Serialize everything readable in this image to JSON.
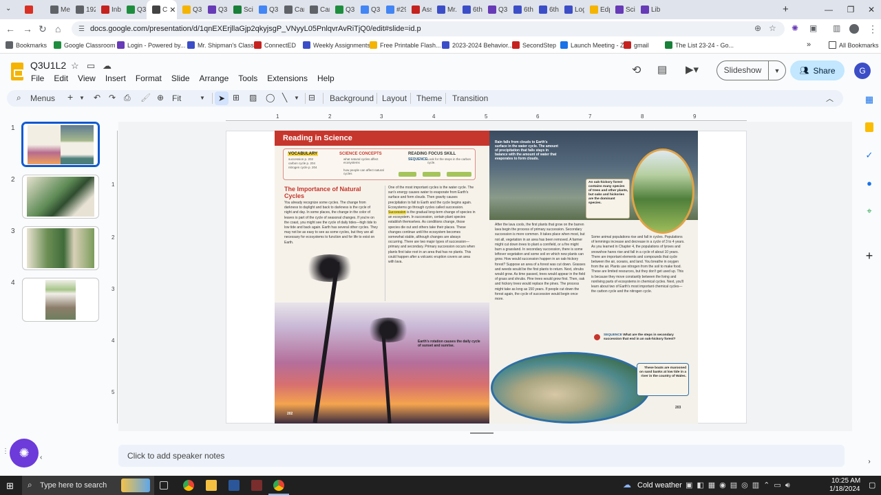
{
  "browser": {
    "tabs": [
      {
        "label": "",
        "icon": "circle-record-icon",
        "color": "#d93025"
      },
      {
        "label": "Me",
        "icon": "globe-icon",
        "color": "#5f6368"
      },
      {
        "label": "192",
        "icon": "clock-icon",
        "color": "#5f6368"
      },
      {
        "label": "Inb",
        "icon": "gmail-icon",
        "color": "#c5221f"
      },
      {
        "label": "Q3",
        "icon": "drive-icon",
        "color": "#1e8e3e"
      },
      {
        "label": "C",
        "icon": "speaker-icon",
        "color": "#444",
        "active": true
      },
      {
        "label": "Q3",
        "icon": "slides-icon",
        "color": "#f4b400"
      },
      {
        "label": "Q3",
        "icon": "forms-icon",
        "color": "#673ab7"
      },
      {
        "label": "Sci",
        "icon": "sheets-icon",
        "color": "#188038"
      },
      {
        "label": "Q3",
        "icon": "docs-icon",
        "color": "#4285f4"
      },
      {
        "label": "Car",
        "icon": "camera-icon",
        "color": "#5f6368"
      },
      {
        "label": "Car",
        "icon": "camera-icon",
        "color": "#5f6368"
      },
      {
        "label": "Q3",
        "icon": "drive-icon",
        "color": "#1e8e3e"
      },
      {
        "label": "Q3",
        "icon": "docs-icon",
        "color": "#4285f4"
      },
      {
        "label": "#29",
        "icon": "docs-icon",
        "color": "#4285f4"
      },
      {
        "label": "Ass",
        "icon": "classroom-icon",
        "color": "#c5221f"
      },
      {
        "label": "Mr.",
        "icon": "bookmark-icon",
        "color": "#3c4ec7"
      },
      {
        "label": "6th",
        "icon": "bookmark-icon",
        "color": "#3c4ec7"
      },
      {
        "label": "Q3",
        "icon": "gear-icon",
        "color": "#673ab7"
      },
      {
        "label": "6th",
        "icon": "bookmark-icon",
        "color": "#3c4ec7"
      },
      {
        "label": "6th",
        "icon": "bookmark-icon",
        "color": "#3c4ec7"
      },
      {
        "label": "Log",
        "icon": "chart-icon",
        "color": "#3c4ec7"
      },
      {
        "label": "Edp",
        "icon": "edpuzzle-icon",
        "color": "#f4b400"
      },
      {
        "label": "Sci",
        "icon": "bookmark-icon",
        "color": "#673ab7"
      },
      {
        "label": "Libr",
        "icon": "gear-icon",
        "color": "#673ab7"
      }
    ],
    "new_tab": "+",
    "url": "docs.google.com/presentation/d/1qnEXErjllaGjp2qkyjsgP_VNyyL05PnlqvrAvRiTjQ0/edit#slide=id.p",
    "bookmarks": [
      {
        "label": "Bookmarks",
        "color": "#5f6368"
      },
      {
        "label": "Google Classroom",
        "color": "#1e8e3e"
      },
      {
        "label": "Login - Powered by...",
        "color": "#673ab7"
      },
      {
        "label": "Mr. Shipman's Class",
        "color": "#3c4ec7"
      },
      {
        "label": "ConnectED",
        "color": "#c5221f"
      },
      {
        "label": "Weekly Assignments",
        "color": "#3c4ec7"
      },
      {
        "label": "Free Printable Flash...",
        "color": "#f4b400"
      },
      {
        "label": "2023-2024 Behavior...",
        "color": "#3c4ec7"
      },
      {
        "label": "SecondStep",
        "color": "#c5221f"
      },
      {
        "label": "Launch Meeting - Z...",
        "color": "#1a73e8"
      },
      {
        "label": "gmail",
        "color": "#c5221f"
      },
      {
        "label": "The List 23-24 - Go...",
        "color": "#188038"
      }
    ],
    "all_bookmarks": "All Bookmarks"
  },
  "app": {
    "title": "Q3U1L2",
    "menu": [
      "File",
      "Edit",
      "View",
      "Insert",
      "Format",
      "Slide",
      "Arrange",
      "Tools",
      "Extensions",
      "Help"
    ],
    "slideshow": "Slideshow",
    "share": "Share",
    "avatar_letter": "G"
  },
  "toolbar": {
    "menus": "Menus",
    "zoom": "Fit",
    "background": "Background",
    "layout": "Layout",
    "theme": "Theme",
    "transition": "Transition"
  },
  "slides": {
    "numbers": [
      "1",
      "2",
      "3",
      "4"
    ]
  },
  "ruler": {
    "h": [
      "1",
      "2",
      "3",
      "4",
      "5",
      "6",
      "7",
      "8",
      "9"
    ],
    "v": [
      "1",
      "2",
      "3",
      "4",
      "5"
    ]
  },
  "slide_content": {
    "header": "Reading in Science",
    "vocab_title": "VOCABULARY",
    "vocab_items": [
      "succession p. 202",
      "carbon cycle p. 204",
      "nitrogen cycle p. 204"
    ],
    "concepts_title": "SCIENCE CONCEPTS",
    "concepts_items": [
      "what natural cycles affect ecosystems",
      "how people can affect natural cycles"
    ],
    "focus_title": "READING FOCUS SKILL",
    "focus_sequence": "SEQUENCE",
    "focus_text": "Look for the steps in the carbon cycle.",
    "article_title": "The Importance of Natural Cycles",
    "col1_text": "You already recognize some cycles. The change from darkness to daylight and back to darkness is the cycle of night and day. In some places, the change in the color of leaves is part of the cycle of seasonal changes. If you're on the coast, you might see the cycle of daily tides—high tide to low tide and back again. Earth has several other cycles. They may not be as easy to see as some cycles, but they are all necessary for ecosystems to function and for life to exist on Earth.",
    "col2_p1": "One of the most important cycles is the water cycle. The sun's energy causes water to evaporate from Earth's surface and form clouds. Then gravity causes precipitation to fall to Earth and the cycle begins again.",
    "col2_p2a": "Ecosystems go through cycles called succession.",
    "col2_highlight": "Succession",
    "col2_p2b": "is the gradual long-term change of species in an ecosystem. In succession, certain plant species establish themselves. As conditions change, those species die out and others take their places. These changes continue until the ecosystem becomes somewhat stable, although changes are always occurring.",
    "col2_p3": "There are two major types of succession—primary and secondary. Primary succession occurs when plants first take root in an area that has no plants. This could happen after a volcanic eruption covers an area with lava.",
    "sunset_caption": "Earth's rotation causes the daily cycle of sunset and sunrise.",
    "page_left": "202",
    "rain_caption": "Rain falls from clouds to Earth's surface in the water cycle. The amount of precipitation that falls stays in balance with the amount of water that evaporates to form clouds.",
    "forest_caption": "An oak-hickory forest contains many species of trees and other plants, but oaks and hickories are the dominant species.",
    "col3_text": "After the lava cools, the first plants that grow on the barren lava begin the process of primary succession. Secondary succession is more common. It takes place when most, but not all, vegetation in an area has been removed. A farmer might cut down trees to plant a cornfield, or a fire might burn a grassland. In secondary succession, there is some leftover vegetation and some soil on which new plants can grow. How would succession happen in an oak-hickory forest? Suppose an area of a forest was cut down. Grasses and weeds would be the first plants to return. Next, shrubs would grow. As time passed, trees would appear in the field of grass and shrubs. Pine trees would grow first. Then, oak and hickory trees would replace the pines. The process might take as long as 150 years. If people cut down the forest again, the cycle of succession would begin once more.",
    "col4_text": "Some animal populations rise and fall in cycles. Populations of lemmings increase and decrease in a cycle of 3 to 4 years. As you learned in Chapter 4, the populations of lynxes and snowshoe hares rise and fall in a cycle of about 10 years. There are important elements and compounds that cycle between the air, oceans, and land. You breathe in oxygen from the air. Plants use nitrogen from the soil to make food. These are limited resources, but they don't get used up. This is because they move constantly between the living and nonliving parts of ecosystems in chemical cycles. Next, you'll learn about two of Earth's most important chemical cycles—the carbon cycle and the nitrogen cycle.",
    "sequence_q_label": "SEQUENCE",
    "sequence_q": "What are the steps in secondary succession that end in an oak-hickory forest?",
    "boats_caption": "These boats are marooned on sand banks at low tide in a river in the country of Wales.",
    "page_right": "203"
  },
  "notes": "Click to add speaker notes",
  "taskbar": {
    "search": "Type here to search",
    "weather": "Cold weather",
    "time": "10:25 AM",
    "date": "1/18/2024"
  },
  "colors": {
    "accent": "#0b57d0",
    "share_bg": "#c2e7ff",
    "header_red": "#c7362c",
    "sky_blue": "#2a5b87"
  }
}
